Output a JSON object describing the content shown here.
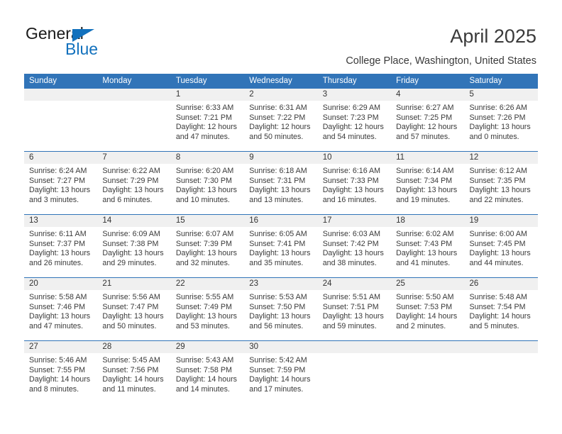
{
  "brand": {
    "word1": "General",
    "word2": "Blue",
    "accent_color": "#1271bd"
  },
  "header": {
    "title": "April 2025",
    "subtitle": "College Place, Washington, United States"
  },
  "calendar": {
    "header_bg": "#3174b8",
    "daynumber_bg": "#f0f0f0",
    "weekday_headers": [
      "Sunday",
      "Monday",
      "Tuesday",
      "Wednesday",
      "Thursday",
      "Friday",
      "Saturday"
    ],
    "weeks": [
      [
        {
          "day": "",
          "lines": []
        },
        {
          "day": "",
          "lines": []
        },
        {
          "day": "1",
          "lines": [
            "Sunrise: 6:33 AM",
            "Sunset: 7:21 PM",
            "Daylight: 12 hours",
            "and 47 minutes."
          ]
        },
        {
          "day": "2",
          "lines": [
            "Sunrise: 6:31 AM",
            "Sunset: 7:22 PM",
            "Daylight: 12 hours",
            "and 50 minutes."
          ]
        },
        {
          "day": "3",
          "lines": [
            "Sunrise: 6:29 AM",
            "Sunset: 7:23 PM",
            "Daylight: 12 hours",
            "and 54 minutes."
          ]
        },
        {
          "day": "4",
          "lines": [
            "Sunrise: 6:27 AM",
            "Sunset: 7:25 PM",
            "Daylight: 12 hours",
            "and 57 minutes."
          ]
        },
        {
          "day": "5",
          "lines": [
            "Sunrise: 6:26 AM",
            "Sunset: 7:26 PM",
            "Daylight: 13 hours",
            "and 0 minutes."
          ]
        }
      ],
      [
        {
          "day": "6",
          "lines": [
            "Sunrise: 6:24 AM",
            "Sunset: 7:27 PM",
            "Daylight: 13 hours",
            "and 3 minutes."
          ]
        },
        {
          "day": "7",
          "lines": [
            "Sunrise: 6:22 AM",
            "Sunset: 7:29 PM",
            "Daylight: 13 hours",
            "and 6 minutes."
          ]
        },
        {
          "day": "8",
          "lines": [
            "Sunrise: 6:20 AM",
            "Sunset: 7:30 PM",
            "Daylight: 13 hours",
            "and 10 minutes."
          ]
        },
        {
          "day": "9",
          "lines": [
            "Sunrise: 6:18 AM",
            "Sunset: 7:31 PM",
            "Daylight: 13 hours",
            "and 13 minutes."
          ]
        },
        {
          "day": "10",
          "lines": [
            "Sunrise: 6:16 AM",
            "Sunset: 7:33 PM",
            "Daylight: 13 hours",
            "and 16 minutes."
          ]
        },
        {
          "day": "11",
          "lines": [
            "Sunrise: 6:14 AM",
            "Sunset: 7:34 PM",
            "Daylight: 13 hours",
            "and 19 minutes."
          ]
        },
        {
          "day": "12",
          "lines": [
            "Sunrise: 6:12 AM",
            "Sunset: 7:35 PM",
            "Daylight: 13 hours",
            "and 22 minutes."
          ]
        }
      ],
      [
        {
          "day": "13",
          "lines": [
            "Sunrise: 6:11 AM",
            "Sunset: 7:37 PM",
            "Daylight: 13 hours",
            "and 26 minutes."
          ]
        },
        {
          "day": "14",
          "lines": [
            "Sunrise: 6:09 AM",
            "Sunset: 7:38 PM",
            "Daylight: 13 hours",
            "and 29 minutes."
          ]
        },
        {
          "day": "15",
          "lines": [
            "Sunrise: 6:07 AM",
            "Sunset: 7:39 PM",
            "Daylight: 13 hours",
            "and 32 minutes."
          ]
        },
        {
          "day": "16",
          "lines": [
            "Sunrise: 6:05 AM",
            "Sunset: 7:41 PM",
            "Daylight: 13 hours",
            "and 35 minutes."
          ]
        },
        {
          "day": "17",
          "lines": [
            "Sunrise: 6:03 AM",
            "Sunset: 7:42 PM",
            "Daylight: 13 hours",
            "and 38 minutes."
          ]
        },
        {
          "day": "18",
          "lines": [
            "Sunrise: 6:02 AM",
            "Sunset: 7:43 PM",
            "Daylight: 13 hours",
            "and 41 minutes."
          ]
        },
        {
          "day": "19",
          "lines": [
            "Sunrise: 6:00 AM",
            "Sunset: 7:45 PM",
            "Daylight: 13 hours",
            "and 44 minutes."
          ]
        }
      ],
      [
        {
          "day": "20",
          "lines": [
            "Sunrise: 5:58 AM",
            "Sunset: 7:46 PM",
            "Daylight: 13 hours",
            "and 47 minutes."
          ]
        },
        {
          "day": "21",
          "lines": [
            "Sunrise: 5:56 AM",
            "Sunset: 7:47 PM",
            "Daylight: 13 hours",
            "and 50 minutes."
          ]
        },
        {
          "day": "22",
          "lines": [
            "Sunrise: 5:55 AM",
            "Sunset: 7:49 PM",
            "Daylight: 13 hours",
            "and 53 minutes."
          ]
        },
        {
          "day": "23",
          "lines": [
            "Sunrise: 5:53 AM",
            "Sunset: 7:50 PM",
            "Daylight: 13 hours",
            "and 56 minutes."
          ]
        },
        {
          "day": "24",
          "lines": [
            "Sunrise: 5:51 AM",
            "Sunset: 7:51 PM",
            "Daylight: 13 hours",
            "and 59 minutes."
          ]
        },
        {
          "day": "25",
          "lines": [
            "Sunrise: 5:50 AM",
            "Sunset: 7:53 PM",
            "Daylight: 14 hours",
            "and 2 minutes."
          ]
        },
        {
          "day": "26",
          "lines": [
            "Sunrise: 5:48 AM",
            "Sunset: 7:54 PM",
            "Daylight: 14 hours",
            "and 5 minutes."
          ]
        }
      ],
      [
        {
          "day": "27",
          "lines": [
            "Sunrise: 5:46 AM",
            "Sunset: 7:55 PM",
            "Daylight: 14 hours",
            "and 8 minutes."
          ]
        },
        {
          "day": "28",
          "lines": [
            "Sunrise: 5:45 AM",
            "Sunset: 7:56 PM",
            "Daylight: 14 hours",
            "and 11 minutes."
          ]
        },
        {
          "day": "29",
          "lines": [
            "Sunrise: 5:43 AM",
            "Sunset: 7:58 PM",
            "Daylight: 14 hours",
            "and 14 minutes."
          ]
        },
        {
          "day": "30",
          "lines": [
            "Sunrise: 5:42 AM",
            "Sunset: 7:59 PM",
            "Daylight: 14 hours",
            "and 17 minutes."
          ]
        },
        {
          "day": "",
          "lines": []
        },
        {
          "day": "",
          "lines": []
        },
        {
          "day": "",
          "lines": []
        }
      ]
    ]
  }
}
